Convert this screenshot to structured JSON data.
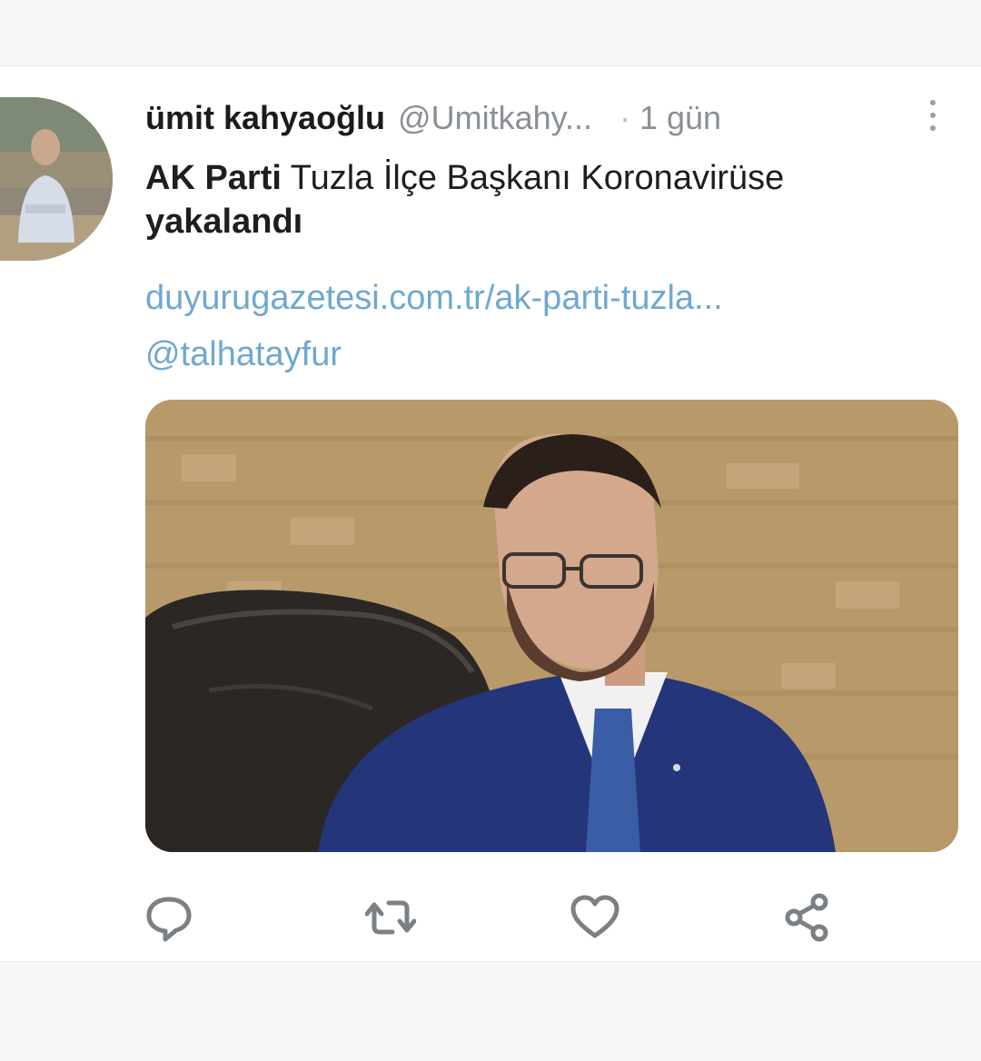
{
  "tweet": {
    "author_name": "ümit kahyaoğlu",
    "author_handle": "@Umitkahy...",
    "separator": "·",
    "time": "1 gün",
    "text_bold": "AK Parti",
    "text_rest": " Tuzla İlçe Başkanı Koronavirüse",
    "text_line2": "yakalandı",
    "link": "duyurugazetesi.com.tr/ak-parti-tuzla...",
    "mention": "@talhatayfur"
  },
  "icons": {
    "more": "more-vertical-icon",
    "reply": "reply-icon",
    "retweet": "retweet-icon",
    "like": "heart-icon",
    "share": "share-icon"
  },
  "colors": {
    "link": "#6fa8cf",
    "text": "#1e1e1e",
    "muted": "#8a8f95",
    "icon": "#7b8085"
  }
}
